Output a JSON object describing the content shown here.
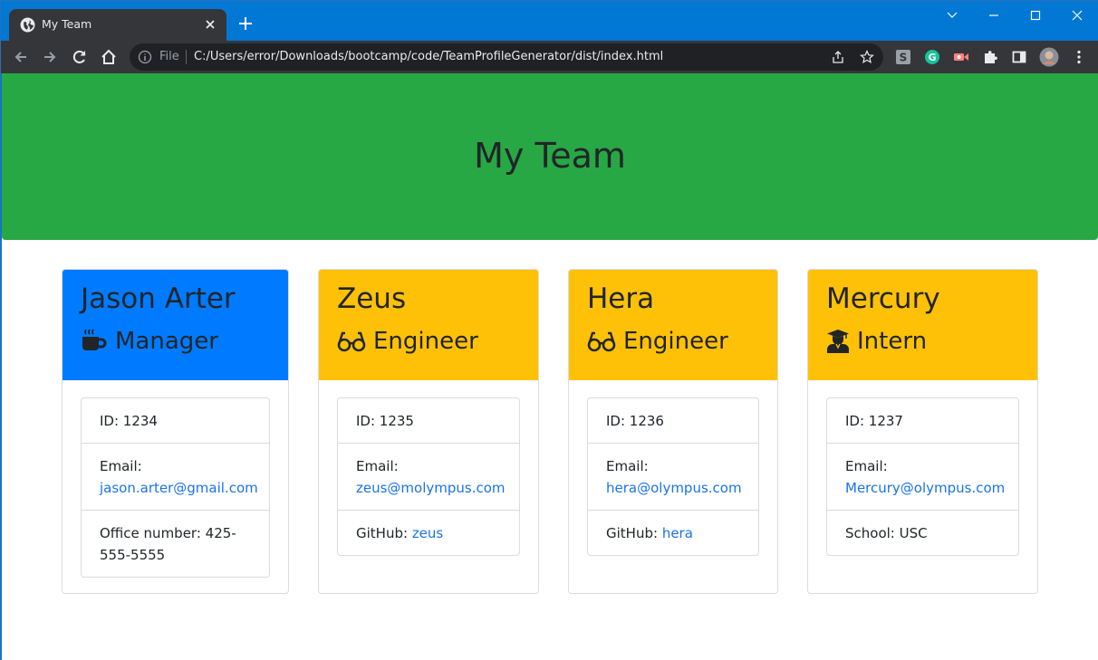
{
  "browser": {
    "tab_title": "My Team",
    "url_scheme_label": "File",
    "url": "C:/Users/error/Downloads/bootcamp/code/TeamProfileGenerator/dist/index.html"
  },
  "page": {
    "heading": "My Team"
  },
  "cards": [
    {
      "name": "Jason Arter",
      "role": "Manager",
      "role_icon": "mug-icon",
      "header_color": "#007bff",
      "id_text": "ID: 1234",
      "email_label": "Email:",
      "email": "jason.arter@gmail.com",
      "extra_label": "Office number: 425-555-5555",
      "extra_link": ""
    },
    {
      "name": "Zeus",
      "role": "Engineer",
      "role_icon": "glasses-icon",
      "header_color": "#ffc107",
      "id_text": "ID: 1235",
      "email_label": "Email:",
      "email": "zeus@molympus.com",
      "extra_label": "GitHub: ",
      "extra_link": "zeus"
    },
    {
      "name": "Hera",
      "role": "Engineer",
      "role_icon": "glasses-icon",
      "header_color": "#ffc107",
      "id_text": "ID: 1236",
      "email_label": "Email:",
      "email": "hera@olympus.com",
      "extra_label": "GitHub: ",
      "extra_link": "hera"
    },
    {
      "name": "Mercury",
      "role": "Intern",
      "role_icon": "graduate-icon",
      "header_color": "#ffc107",
      "id_text": "ID: 1237",
      "email_label": "Email:",
      "email": "Mercury@olympus.com",
      "extra_label": "School: USC",
      "extra_link": ""
    }
  ],
  "colors": {
    "jumbotron": "#28a745",
    "link": "#1a73e8"
  }
}
